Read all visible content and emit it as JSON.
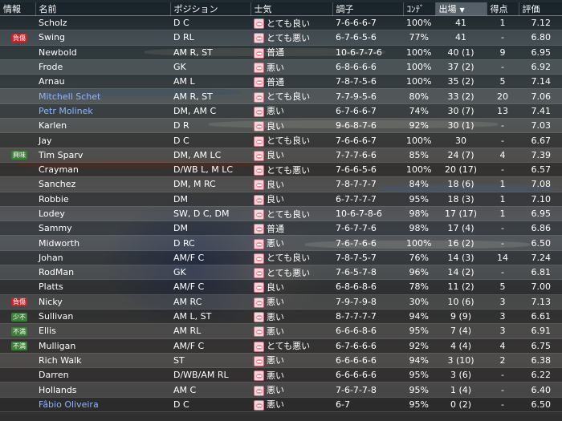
{
  "columns": {
    "info": "情報",
    "name": "名前",
    "position": "ポジション",
    "morale": "士気",
    "form": "調子",
    "condition": "ｺﾝﾃﾞ",
    "apps": "出場",
    "goals": "得点",
    "rating": "評価"
  },
  "sort_indicator": "▼",
  "colors": {
    "injury_badge": "#c0262b",
    "interest_badge": "#3f7d3a",
    "unhappy_badge": "#3f7d3a",
    "link_name": "#8fb5ff"
  },
  "players": [
    {
      "badge": "",
      "name": "Scholz",
      "position": "D C",
      "morale": "とても良い",
      "form": "7-6-6-6-7",
      "condition": "100%",
      "apps": "41",
      "goals": "1",
      "rating": "7.12"
    },
    {
      "badge": "負傷",
      "badge_type": "injury",
      "name": "Swing",
      "position": "D RL",
      "morale": "とても悪い",
      "form": "6-7-6-5-6",
      "condition": "77%",
      "apps": "41",
      "goals": "-",
      "rating": "6.80"
    },
    {
      "badge": "",
      "name": "Newbold",
      "position": "AM R, ST",
      "morale": "普通",
      "form": "10-6-7-7-6",
      "condition": "100%",
      "apps": "40 (1)",
      "goals": "9",
      "rating": "6.95"
    },
    {
      "badge": "",
      "name": "Frode",
      "position": "GK",
      "morale": "悪い",
      "form": "6-8-6-6-6",
      "condition": "100%",
      "apps": "37 (2)",
      "goals": "-",
      "rating": "6.92"
    },
    {
      "badge": "",
      "name": "Arnau",
      "position": "AM L",
      "morale": "普通",
      "form": "7-8-7-5-6",
      "condition": "100%",
      "apps": "35 (2)",
      "goals": "5",
      "rating": "7.14"
    },
    {
      "badge": "",
      "name": "Mitchell Schet",
      "link": true,
      "position": "AM R, ST",
      "morale": "とても良い",
      "form": "7-7-9-5-6",
      "condition": "80%",
      "apps": "33 (2)",
      "goals": "20",
      "rating": "7.06"
    },
    {
      "badge": "",
      "name": "Petr Molinek",
      "link": true,
      "position": "DM, AM C",
      "morale": "悪い",
      "form": "6-7-6-6-7",
      "condition": "74%",
      "apps": "30 (7)",
      "goals": "13",
      "rating": "7.41"
    },
    {
      "badge": "",
      "name": "Karlen",
      "position": "D R",
      "morale": "良い",
      "form": "9-6-8-7-6",
      "condition": "92%",
      "apps": "30 (1)",
      "goals": "-",
      "rating": "7.03"
    },
    {
      "badge": "",
      "name": "Jay",
      "position": "D C",
      "morale": "とても良い",
      "form": "7-6-6-6-7",
      "condition": "100%",
      "apps": "30",
      "goals": "-",
      "rating": "6.67"
    },
    {
      "badge": "興味",
      "badge_type": "interest",
      "name": "Tim Sparv",
      "position": "DM, AM LC",
      "morale": "良い",
      "form": "7-7-7-6-6",
      "condition": "85%",
      "apps": "24 (7)",
      "goals": "4",
      "rating": "7.39"
    },
    {
      "badge": "",
      "name": "Crayman",
      "position": "D/WB L, M LC",
      "morale": "とても悪い",
      "form": "7-6-6-5-6",
      "condition": "100%",
      "apps": "20 (17)",
      "goals": "-",
      "rating": "6.57"
    },
    {
      "badge": "",
      "name": "Sanchez",
      "position": "DM, M RC",
      "morale": "良い",
      "form": "7-8-7-7-7",
      "condition": "84%",
      "apps": "18 (6)",
      "goals": "1",
      "rating": "7.08"
    },
    {
      "badge": "",
      "name": "Robbie",
      "position": "DM",
      "morale": "良い",
      "form": "6-7-7-7-7",
      "condition": "95%",
      "apps": "18 (3)",
      "goals": "1",
      "rating": "7.10"
    },
    {
      "badge": "",
      "name": "Lodey",
      "position": "SW, D C, DM",
      "morale": "とても良い",
      "form": "10-6-7-8-6",
      "condition": "98%",
      "apps": "17 (17)",
      "goals": "1",
      "rating": "6.95"
    },
    {
      "badge": "",
      "name": "Sammy",
      "position": "DM",
      "morale": "普通",
      "form": "7-6-7-7-6",
      "condition": "98%",
      "apps": "17 (4)",
      "goals": "-",
      "rating": "6.86"
    },
    {
      "badge": "",
      "name": "Midworth",
      "position": "D RC",
      "morale": "悪い",
      "form": "7-6-7-6-6",
      "condition": "100%",
      "apps": "16 (2)",
      "goals": "-",
      "rating": "6.50"
    },
    {
      "badge": "",
      "name": "Johan",
      "position": "AM/F C",
      "morale": "とても良い",
      "form": "7-8-7-5-7",
      "condition": "76%",
      "apps": "14 (3)",
      "goals": "14",
      "rating": "7.24"
    },
    {
      "badge": "",
      "name": "RodMan",
      "position": "GK",
      "morale": "とても悪い",
      "form": "7-6-5-7-8",
      "condition": "96%",
      "apps": "14 (2)",
      "goals": "-",
      "rating": "6.81"
    },
    {
      "badge": "",
      "name": "Platts",
      "position": "AM/F C",
      "morale": "良い",
      "form": "6-8-6-8-6",
      "condition": "78%",
      "apps": "11 (2)",
      "goals": "5",
      "rating": "7.00"
    },
    {
      "badge": "負傷",
      "badge_type": "injury",
      "name": "Nicky",
      "position": "AM RC",
      "morale": "悪い",
      "form": "7-9-7-9-8",
      "condition": "30%",
      "apps": "10 (6)",
      "goals": "3",
      "rating": "7.13"
    },
    {
      "badge": "少不",
      "badge_type": "unhappy",
      "name": "Sullivan",
      "position": "AM L, ST",
      "morale": "悪い",
      "form": "8-7-7-7-7",
      "condition": "94%",
      "apps": "9 (9)",
      "goals": "3",
      "rating": "6.61"
    },
    {
      "badge": "不満",
      "badge_type": "unhappy",
      "name": "Ellis",
      "position": "AM RL",
      "morale": "悪い",
      "form": "6-6-6-8-6",
      "condition": "95%",
      "apps": "7 (4)",
      "goals": "3",
      "rating": "6.91"
    },
    {
      "badge": "不満",
      "badge_type": "unhappy",
      "name": "Mulligan",
      "position": "AM/F C",
      "morale": "とても悪い",
      "form": "6-7-6-6-6",
      "condition": "92%",
      "apps": "4 (4)",
      "goals": "4",
      "rating": "6.75"
    },
    {
      "badge": "",
      "name": "Rich Walk",
      "position": "ST",
      "morale": "悪い",
      "form": "6-6-6-6-6",
      "condition": "94%",
      "apps": "3 (10)",
      "goals": "2",
      "rating": "6.38"
    },
    {
      "badge": "",
      "name": "Darren",
      "position": "D/WB/AM RL",
      "morale": "悪い",
      "form": "6-6-6-6-6",
      "condition": "95%",
      "apps": "3 (6)",
      "goals": "-",
      "rating": "6.22"
    },
    {
      "badge": "",
      "name": "Hollands",
      "position": "AM C",
      "morale": "悪い",
      "form": "7-6-7-7-8",
      "condition": "95%",
      "apps": "1 (4)",
      "goals": "-",
      "rating": "6.40"
    },
    {
      "badge": "",
      "name": "Fâbio Oliveira",
      "link": true,
      "position": "D C",
      "morale": "悪い",
      "form": "6-7",
      "condition": "95%",
      "apps": "0 (2)",
      "goals": "-",
      "rating": "6.50"
    }
  ]
}
